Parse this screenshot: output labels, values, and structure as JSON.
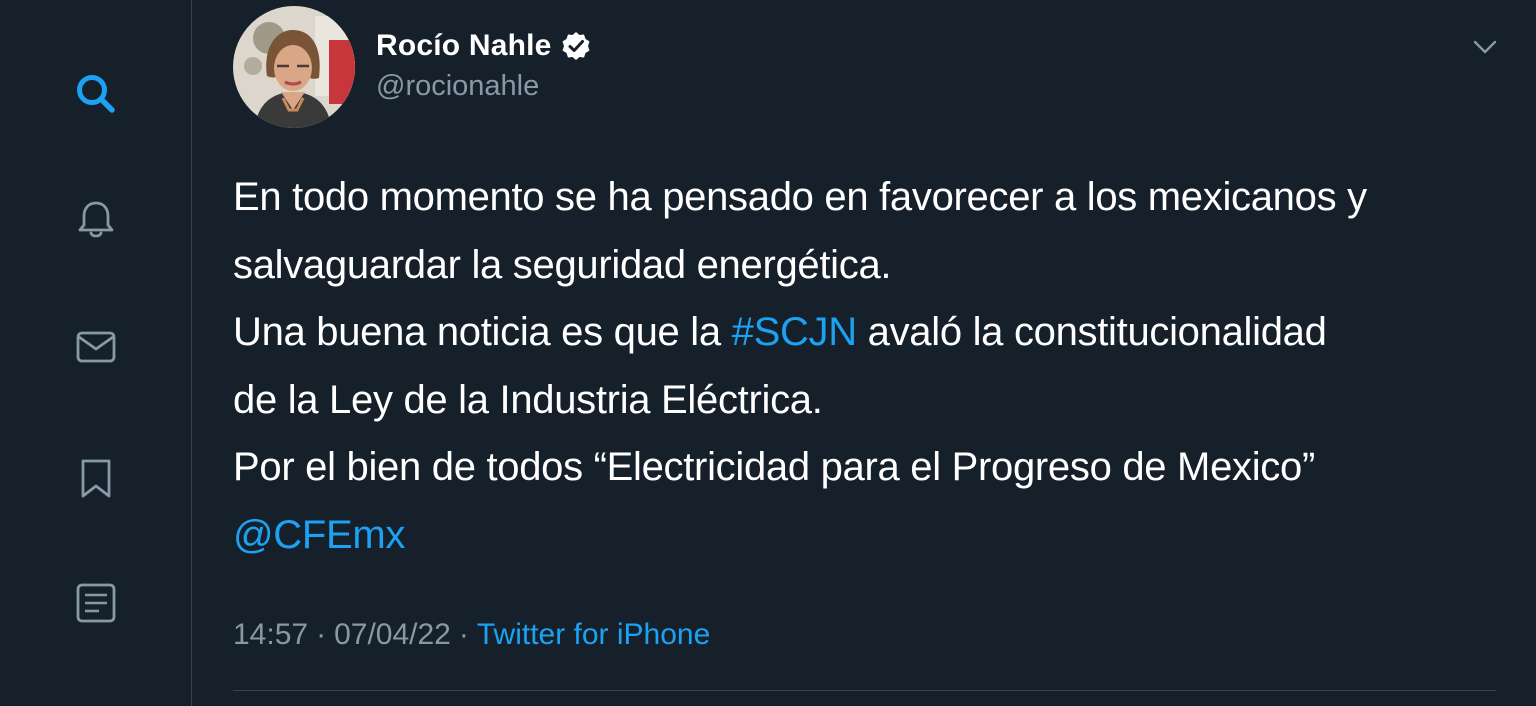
{
  "sidebar": {
    "items": [
      {
        "name": "search",
        "icon": "search-icon",
        "active": true
      },
      {
        "name": "notifications",
        "icon": "bell-icon",
        "active": false
      },
      {
        "name": "messages",
        "icon": "envelope-icon",
        "active": false
      },
      {
        "name": "bookmarks",
        "icon": "bookmark-icon",
        "active": false
      },
      {
        "name": "lists",
        "icon": "list-icon",
        "active": false
      }
    ]
  },
  "tweet": {
    "author": {
      "display_name": "Rocío Nahle",
      "username": "@rocionahle",
      "verified": true
    },
    "text": {
      "line1": "En todo momento se ha pensado en favorecer a los mexicanos y",
      "line2": "salvaguardar la seguridad energética.",
      "line3_before": "Una buena noticia es que la ",
      "hashtag": "#SCJN",
      "line3_after": " avaló la constitucionalidad",
      "line4": "de la Ley de la Industria Eléctrica.",
      "line5": "Por el bien de todos “Electricidad para el Progreso de Mexico”",
      "mention": "@CFEmx"
    },
    "time": "14:57",
    "date": "07/04/22",
    "separator": "·",
    "source": "Twitter for iPhone"
  },
  "colors": {
    "background": "#15202b",
    "accent": "#1da1f2",
    "secondary_text": "#8899a6",
    "border": "#38444d"
  }
}
